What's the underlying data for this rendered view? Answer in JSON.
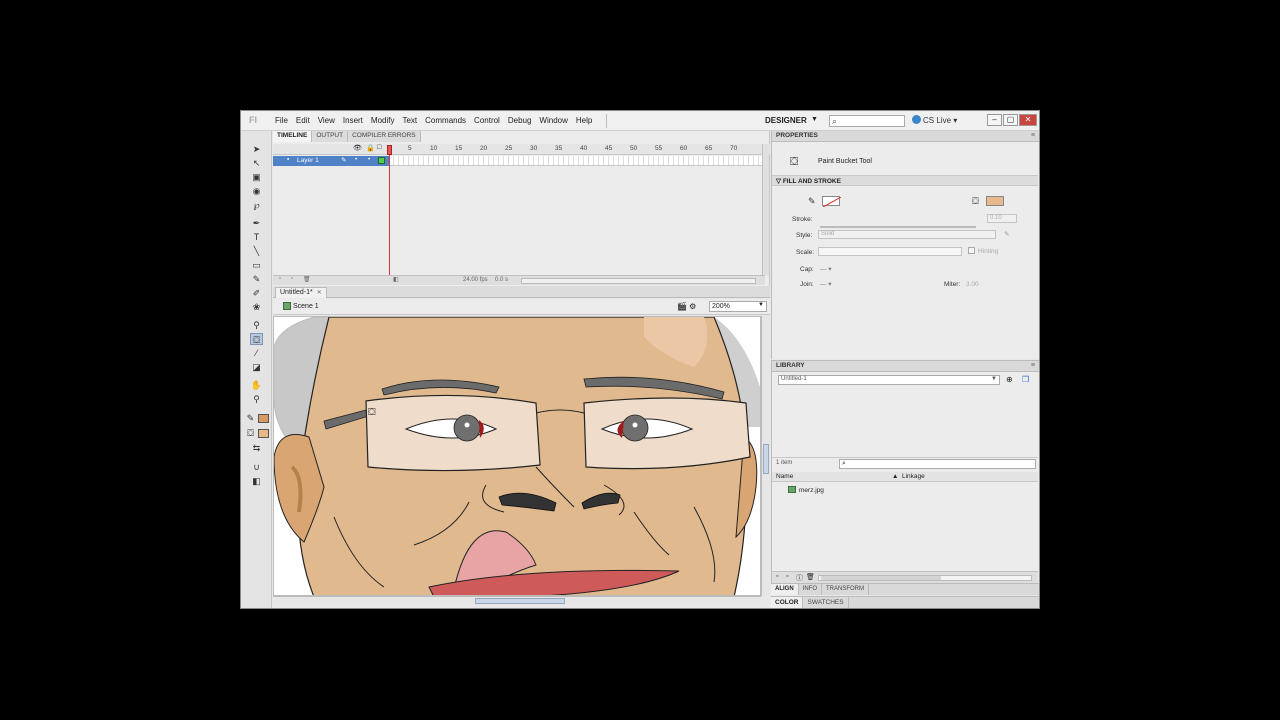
{
  "menu": [
    "File",
    "Edit",
    "View",
    "Insert",
    "Modify",
    "Text",
    "Commands",
    "Control",
    "Debug",
    "Window",
    "Help"
  ],
  "app_logo": "Fl",
  "workspace": "DESIGNER",
  "cs_live": "CS Live",
  "timeline": {
    "tabs": [
      "TIMELINE",
      "OUTPUT",
      "COMPILER ERRORS"
    ],
    "ruler": [
      "5",
      "10",
      "15",
      "20",
      "25",
      "30",
      "35",
      "40",
      "45",
      "50",
      "55",
      "60",
      "65",
      "70"
    ],
    "layer_name": "Layer 1",
    "fps": "24.00 fps",
    "time": "0.0 s"
  },
  "document": {
    "tab": "Untitled-1*",
    "scene": "Scene 1",
    "zoom": "200%"
  },
  "properties": {
    "title": "PROPERTIES",
    "tool_name": "Paint Bucket Tool",
    "section": "FILL AND STROKE",
    "stroke_label": "Stroke:",
    "stroke_value": "0.10",
    "style_label": "Style:",
    "style_value": "Solid",
    "scale_label": "Scale:",
    "hinting": "Hinting",
    "cap_label": "Cap:",
    "join_label": "Join:",
    "miter_label": "Miter:",
    "miter_value": "3.00",
    "fill_color": "#e8b98a"
  },
  "library": {
    "title": "LIBRARY",
    "doc": "Untitled-1",
    "count": "1 item",
    "col_name": "Name",
    "col_linkage": "Linkage",
    "item": "merz.jpg"
  },
  "bottom_tabs": [
    "ALIGN",
    "INFO",
    "TRANSFORM"
  ],
  "color_tabs": [
    "COLOR",
    "SWATCHES"
  ]
}
